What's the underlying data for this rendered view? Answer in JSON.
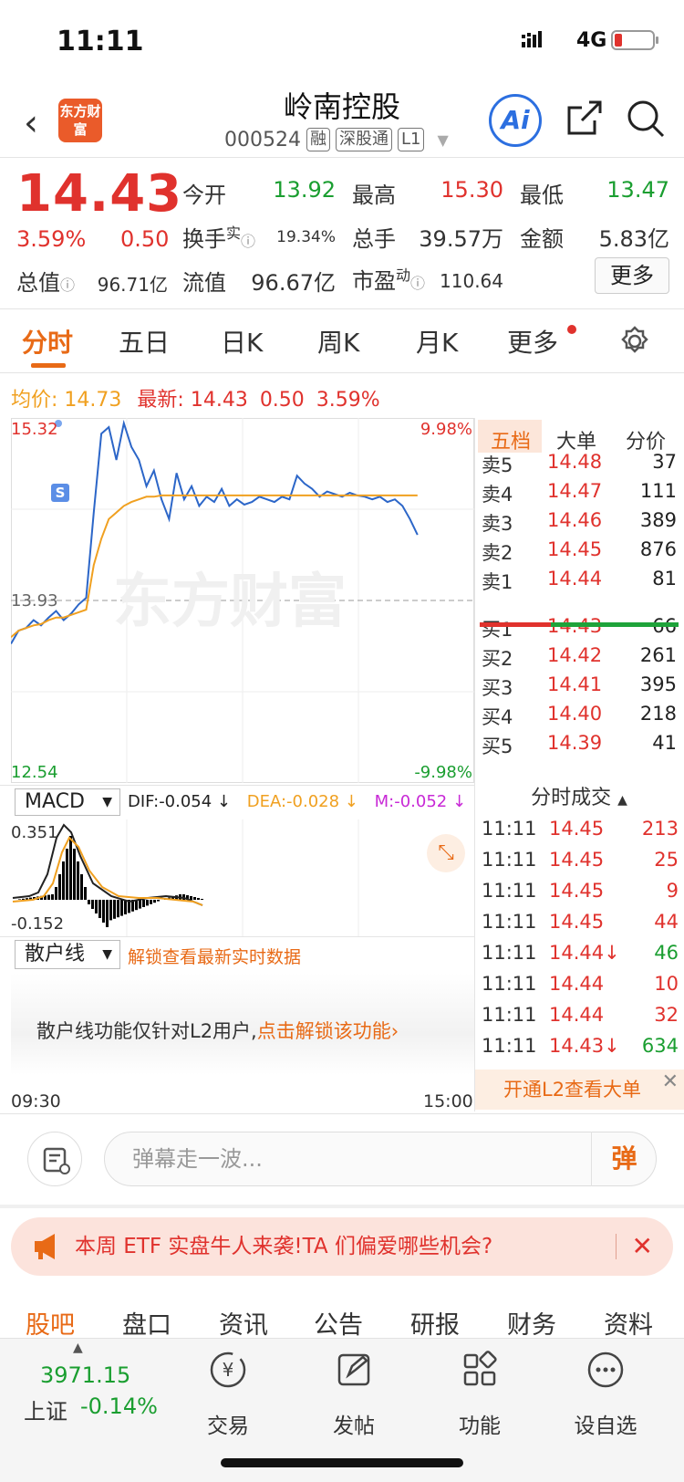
{
  "status_bar": {
    "time": "11:11",
    "network": "4G"
  },
  "header": {
    "logo_text": "东方财富",
    "title": "岭南控股",
    "code": "000524",
    "tags": [
      "融",
      "深股通",
      "L1"
    ],
    "ai_label": "Ai"
  },
  "quote": {
    "price": "14.43",
    "change_pct": "3.59%",
    "change": "0.50",
    "open_label": "今开",
    "open": "13.92",
    "high_label": "最高",
    "high": "15.30",
    "low_label": "最低",
    "low": "13.47",
    "turnover_label": "换手",
    "turnover_sup": "实",
    "turnover": "19.34%",
    "volume_label": "总手",
    "volume": "39.57万",
    "amount_label": "金额",
    "amount": "5.83亿",
    "mcap_label": "总值",
    "mcap": "96.71亿",
    "float_label": "流值",
    "float": "96.67亿",
    "pe_label": "市盈",
    "pe_sup": "动",
    "pe": "110.64",
    "more_label": "更多"
  },
  "tabs": [
    "分时",
    "五日",
    "日K",
    "周K",
    "月K",
    "更多",
    "settings"
  ],
  "avg_line": {
    "avg_label": "均价:",
    "avg": "14.73",
    "latest_label": "最新:",
    "latest": "14.43",
    "chg": "0.50",
    "pct": "3.59%"
  },
  "chart": {
    "ymax_label": "15.32",
    "ymin_label": "12.54",
    "ref_label": "13.93",
    "pct_max": "9.98%",
    "pct_min": "-9.98%",
    "time_start": "09:30",
    "time_end": "15:00",
    "watermark": "东方财富",
    "marker": "S",
    "colors": {
      "price": "#2c66c8",
      "avg": "#f0a020"
    }
  },
  "chart_data": {
    "type": "line",
    "ylim": [
      12.54,
      15.32
    ],
    "reference": 13.93,
    "series": [
      {
        "values": [
          13.6,
          13.7,
          13.72,
          13.78,
          13.74,
          13.8,
          13.85,
          13.78,
          13.83,
          13.9,
          13.95,
          14.6,
          15.2,
          15.25,
          15.0,
          15.28,
          15.1,
          15.0,
          14.8,
          14.92,
          14.7,
          14.55,
          14.9,
          14.7,
          14.8,
          14.65,
          14.72,
          14.68,
          14.78,
          14.65,
          14.7,
          14.66,
          14.68,
          14.72,
          14.7,
          14.68,
          14.72,
          14.7,
          14.88,
          14.82,
          14.78,
          14.72,
          14.76,
          14.74,
          14.72,
          14.75,
          14.73,
          14.72,
          14.7,
          14.72,
          14.68,
          14.7,
          14.65,
          14.55,
          14.43
        ]
      },
      {
        "values": [
          13.65,
          13.7,
          13.72,
          13.74,
          13.75,
          13.78,
          13.8,
          13.8,
          13.82,
          13.84,
          13.86,
          14.2,
          14.4,
          14.55,
          14.6,
          14.65,
          14.68,
          14.7,
          14.72,
          14.72,
          14.73,
          14.73,
          14.73,
          14.73,
          14.73,
          14.73,
          14.73,
          14.73,
          14.73,
          14.73,
          14.73,
          14.73,
          14.73,
          14.73,
          14.73,
          14.73,
          14.73,
          14.73,
          14.73,
          14.73,
          14.73,
          14.73,
          14.73,
          14.73,
          14.73,
          14.73,
          14.73,
          14.73,
          14.73,
          14.73,
          14.73,
          14.73,
          14.73,
          14.73,
          14.73
        ]
      }
    ]
  },
  "order_book": {
    "tabs": [
      "五档",
      "大单",
      "分价"
    ],
    "asks": [
      {
        "label": "卖5",
        "price": "14.48",
        "vol": "37"
      },
      {
        "label": "卖4",
        "price": "14.47",
        "vol": "111"
      },
      {
        "label": "卖3",
        "price": "14.46",
        "vol": "389"
      },
      {
        "label": "卖2",
        "price": "14.45",
        "vol": "876"
      },
      {
        "label": "卖1",
        "price": "14.44",
        "vol": "81"
      }
    ],
    "bids": [
      {
        "label": "买1",
        "price": "14.43",
        "vol": "66"
      },
      {
        "label": "买2",
        "price": "14.42",
        "vol": "261"
      },
      {
        "label": "买3",
        "price": "14.41",
        "vol": "395"
      },
      {
        "label": "买4",
        "price": "14.40",
        "vol": "218"
      },
      {
        "label": "买5",
        "price": "14.39",
        "vol": "41"
      }
    ],
    "ratio_sell": 0.36
  },
  "trades": {
    "header": "分时成交",
    "rows": [
      {
        "t": "11:11",
        "p": "14.45",
        "v": "213",
        "dir": "up"
      },
      {
        "t": "11:11",
        "p": "14.45",
        "v": "25",
        "dir": "up"
      },
      {
        "t": "11:11",
        "p": "14.45",
        "v": "9",
        "dir": "up"
      },
      {
        "t": "11:11",
        "p": "14.45",
        "v": "44",
        "dir": "up"
      },
      {
        "t": "11:11",
        "p": "14.44↓",
        "v": "46",
        "dir": "down"
      },
      {
        "t": "11:11",
        "p": "14.44",
        "v": "10",
        "dir": "up"
      },
      {
        "t": "11:11",
        "p": "14.44",
        "v": "32",
        "dir": "up"
      },
      {
        "t": "11:11",
        "p": "14.43↓",
        "v": "634",
        "dir": "down"
      }
    ],
    "l2_label": "开通L2查看大单"
  },
  "macd": {
    "selector": "MACD",
    "dif": "DIF:-0.054 ↓",
    "dea": "DEA:-0.028 ↓",
    "m": "M:-0.052 ↓",
    "ymax_label": "0.351",
    "ymin_label": "-0.152"
  },
  "retail": {
    "selector": "散户线",
    "unlock_text": "解锁查看最新实时数据",
    "msg": "散户线功能仅针对L2用户,",
    "msg_link": "点击解锁该功能"
  },
  "danmaku": {
    "placeholder": "弹幕走一波...",
    "button": "弹"
  },
  "banner": {
    "text": "本周 ETF 实盘牛人来袭!TA 们偏爱哪些机会?"
  },
  "bottom_tabs": [
    "股吧",
    "盘口",
    "资讯",
    "公告",
    "研报",
    "财务",
    "资料"
  ],
  "footer": {
    "index_value": "3971.15",
    "index_name": "上证",
    "index_pct": "-0.14%",
    "items": [
      "交易",
      "发帖",
      "功能",
      "设自选"
    ]
  }
}
